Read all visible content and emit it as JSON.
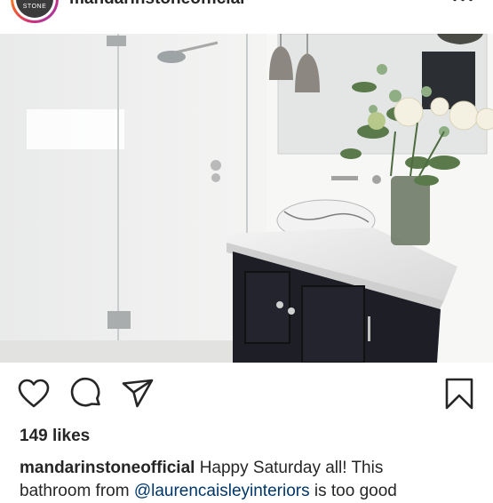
{
  "post": {
    "username": "mandarinstoneofficial",
    "avatar_text": "STONE",
    "likes": "149 likes",
    "caption_user": "mandarinstoneofficial",
    "caption_text_1": " Happy Saturday all! This",
    "caption_text_2": "bathroom from ",
    "caption_mention": "@laurencaisleyinteriors",
    "caption_text_3": " is too good"
  },
  "icons": {
    "more": "more-horizontal-icon",
    "like": "heart-icon",
    "comment": "comment-icon",
    "share": "send-icon",
    "save": "bookmark-icon"
  },
  "colors": {
    "text": "#262626",
    "mention": "#00376b",
    "vanity_cabinet": "#1d1e26"
  }
}
